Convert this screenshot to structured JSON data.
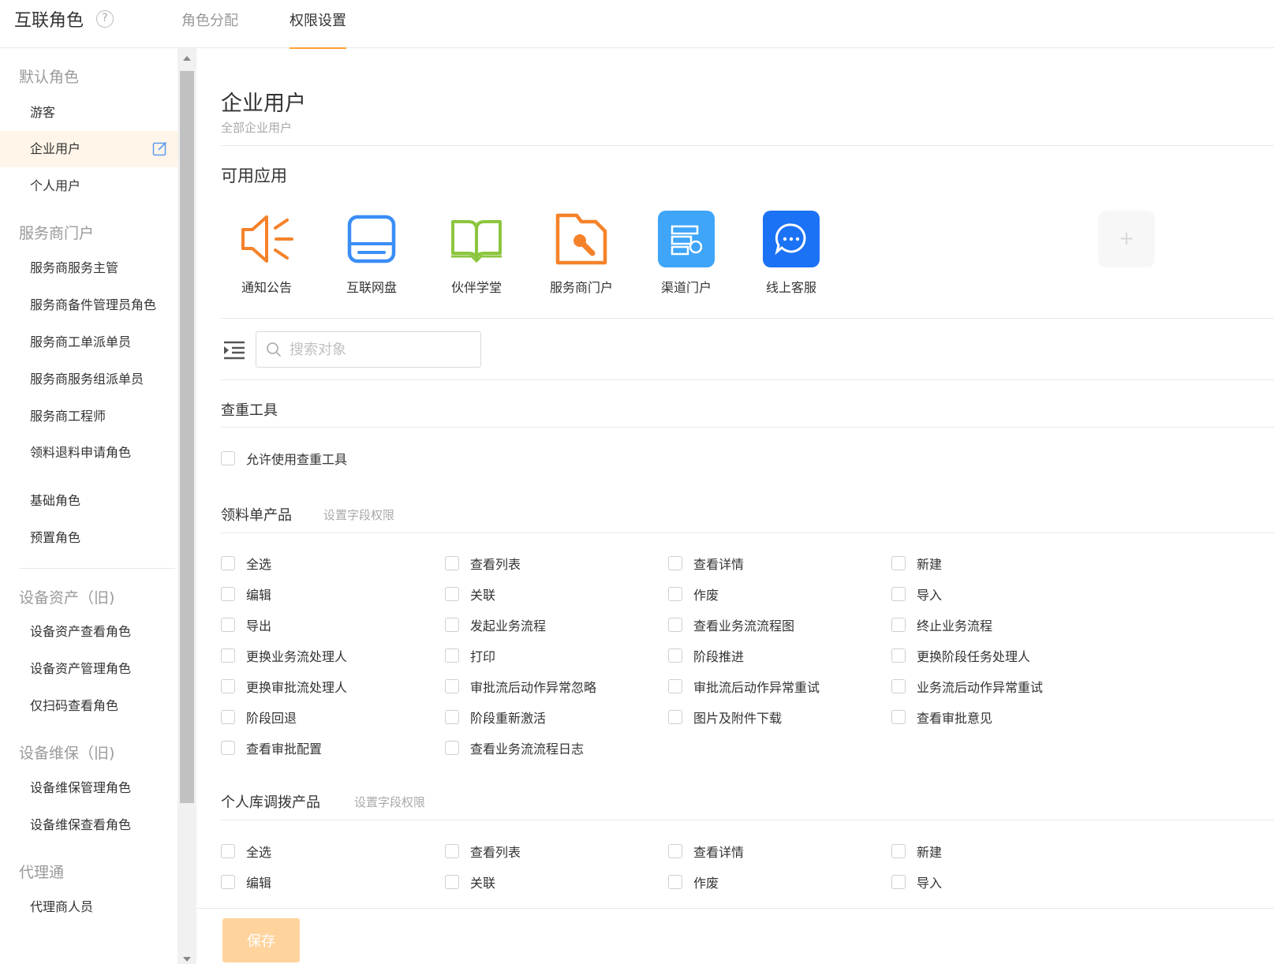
{
  "header": {
    "app_title": "互联角色",
    "help_icon": "question-circle-icon",
    "tabs": [
      {
        "label": "角色分配",
        "active": false
      },
      {
        "label": "权限设置",
        "active": true
      }
    ]
  },
  "sidebar": {
    "groups": [
      {
        "label": "默认角色",
        "items": [
          "游客",
          "企业用户",
          "个人用户"
        ]
      },
      {
        "label": "服务商门户",
        "items": [
          "服务商服务主管",
          "服务商备件管理员角色",
          "服务商工单派单员",
          "服务商服务组派单员",
          "服务商工程师",
          "领料退料申请角色"
        ]
      },
      {
        "label": "",
        "items": [
          "基础角色",
          "预置角色"
        ]
      },
      {
        "label": "设备资产（旧)",
        "items": [
          "设备资产查看角色",
          "设备资产管理角色",
          "仅扫码查看角色"
        ]
      },
      {
        "label": "设备维保（旧)",
        "items": [
          "设备维保管理角色",
          "设备维保查看角色"
        ]
      },
      {
        "label": "代理通",
        "items": [
          "代理商人员"
        ]
      }
    ],
    "active_item": "企业用户"
  },
  "main": {
    "title": "企业用户",
    "subtitle": "全部企业用户",
    "apps_title": "可用应用",
    "apps": [
      {
        "label": "通知公告",
        "icon": "megaphone-icon",
        "color": "#f5822a"
      },
      {
        "label": "互联网盘",
        "icon": "hard-drive-icon",
        "color": "#3a8ef6"
      },
      {
        "label": "伙伴学堂",
        "icon": "open-book-icon",
        "color": "#8cc63f"
      },
      {
        "label": "服务商门户",
        "icon": "folder-wrench-icon",
        "color": "#f5822a"
      },
      {
        "label": "渠道门户",
        "icon": "server-gear-icon",
        "color": "#3ea5f8"
      },
      {
        "label": "线上客服",
        "icon": "chat-bubble-icon",
        "color": "#1b72f5"
      }
    ],
    "add_app_label": "+",
    "search": {
      "placeholder": "搜索对象"
    },
    "dedup": {
      "title": "查重工具",
      "option": "允许使用查重工具"
    },
    "group1": {
      "title": "领料单产品",
      "link": "设置字段权限",
      "options": [
        "全选",
        "查看列表",
        "查看详情",
        "新建",
        "编辑",
        "关联",
        "作废",
        "导入",
        "导出",
        "发起业务流程",
        "查看业务流流程图",
        "终止业务流程",
        "更换业务流处理人",
        "打印",
        "阶段推进",
        "更换阶段任务处理人",
        "更换审批流处理人",
        "审批流后动作异常忽略",
        "审批流后动作异常重试",
        "业务流后动作异常重试",
        "阶段回退",
        "阶段重新激活",
        "图片及附件下载",
        "查看审批意见",
        "查看审批配置",
        "查看业务流流程日志"
      ]
    },
    "group2": {
      "title": "个人库调拨产品",
      "link": "设置字段权限",
      "options": [
        "全选",
        "查看列表",
        "查看详情",
        "新建",
        "编辑",
        "关联",
        "作废",
        "导入"
      ]
    }
  },
  "footer": {
    "save_label": "保存"
  },
  "colors": {
    "accent": "#ffa233",
    "save_button": "#ffd39c",
    "active_bg": "#fff5e8"
  }
}
